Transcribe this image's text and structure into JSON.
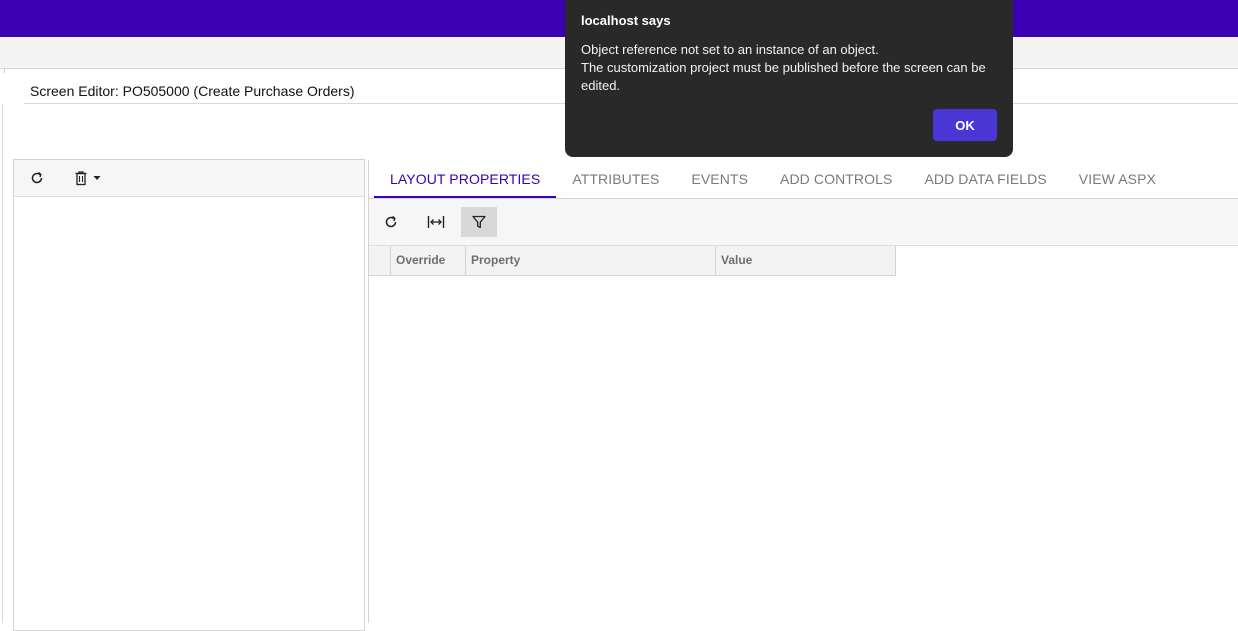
{
  "page": {
    "screen_title": "Screen Editor: PO505000 (Create Purchase Orders)"
  },
  "left_toolbar": {
    "refresh_icon": "refresh-icon",
    "delete_icon": "trash-icon",
    "dropdown_icon": "caret-down-icon"
  },
  "tabs": [
    {
      "label": "LAYOUT PROPERTIES",
      "active": true
    },
    {
      "label": "ATTRIBUTES",
      "active": false
    },
    {
      "label": "EVENTS",
      "active": false
    },
    {
      "label": "ADD CONTROLS",
      "active": false
    },
    {
      "label": "ADD DATA FIELDS",
      "active": false
    },
    {
      "label": "VIEW ASPX",
      "active": false
    }
  ],
  "grid_toolbar": {
    "refresh_icon": "refresh-icon",
    "fit_icon": "fit-width-icon",
    "filter_icon": "filter-icon"
  },
  "grid": {
    "columns": [
      "Override",
      "Property",
      "Value"
    ],
    "rows": []
  },
  "dialog": {
    "title": "localhost says",
    "message_line1": "Object reference not set to an instance of an object.",
    "message_line2": "The customization project must be published before the screen can be edited.",
    "ok_label": "OK"
  },
  "colors": {
    "brand": "#3a00b2",
    "dialog_bg": "#292929",
    "ok_button": "#4a36d4"
  }
}
